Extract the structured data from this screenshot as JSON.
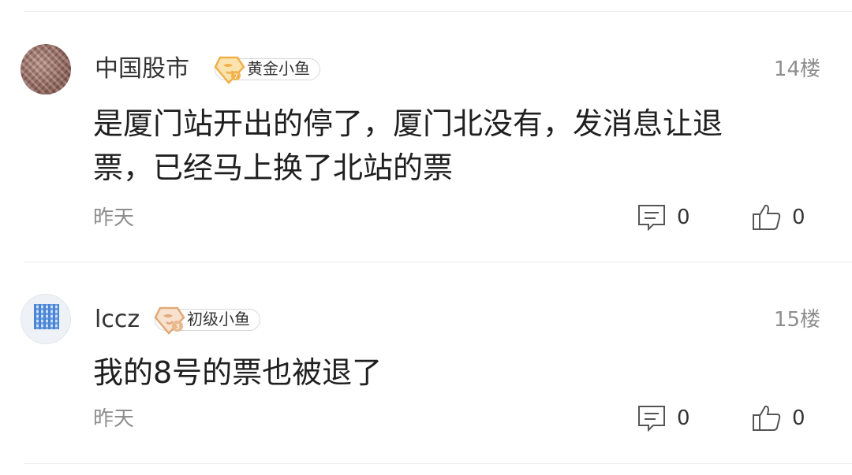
{
  "comments": [
    {
      "username": "中国股市",
      "badge": {
        "label": "黄金小鱼",
        "level_color": "#f3b24a"
      },
      "floor": "14楼",
      "text": "是厦门站开出的停了，厦门北没有，发消息让退票，已经马上换了北站的票",
      "time": "昨天",
      "reply_count": "0",
      "like_count": "0"
    },
    {
      "username": "lccz",
      "badge": {
        "label": "初级小鱼",
        "level_badge": "3",
        "level_color": "#e9b98c"
      },
      "floor": "15楼",
      "text": "我的8号的票也被退了",
      "time": "昨天",
      "reply_count": "0",
      "like_count": "0"
    }
  ],
  "icons": {
    "comment": "comment-icon",
    "like": "thumbs-up-icon",
    "badge": "fish-badge-icon"
  }
}
